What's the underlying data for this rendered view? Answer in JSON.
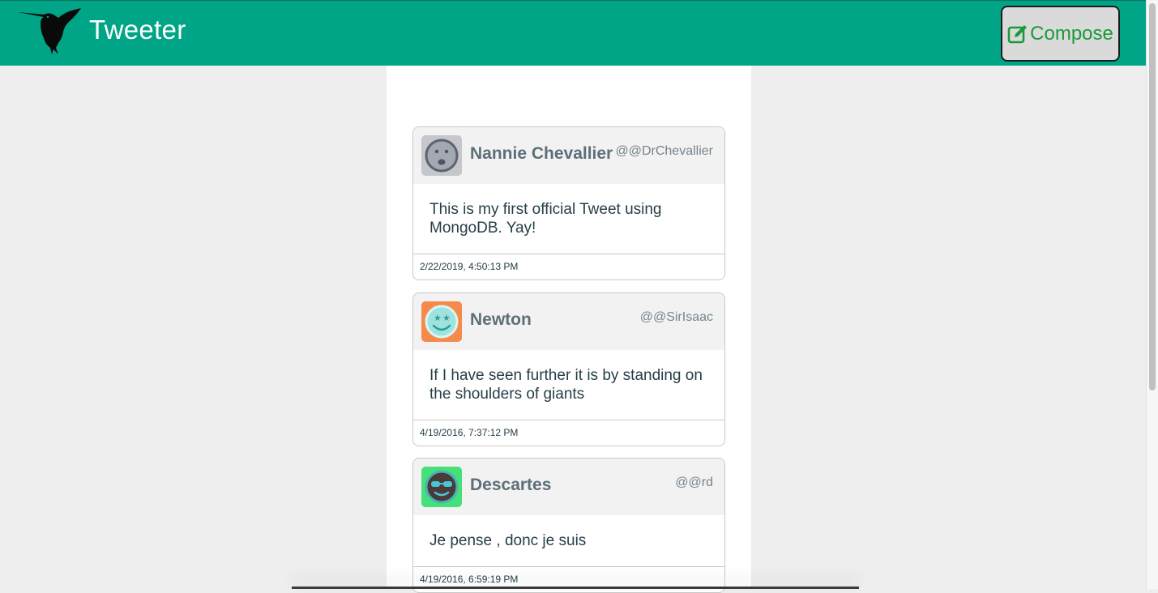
{
  "navbar": {
    "title": "Tweeter",
    "compose_label": "Compose",
    "bird_icon": "hummingbird-icon",
    "compose_icon": "edit-square-icon",
    "accent_color": "#00a587",
    "compose_color": "#1a9a3a"
  },
  "tweets": [
    {
      "name": "Nannie Chevallier",
      "handle": "@@DrChevallier",
      "text": "This is my first official Tweet using MongoDB. Yay!",
      "timestamp": "2/22/2019, 4:50:13 PM",
      "avatar_icon": "surprised-face-avatar-icon",
      "avatar_color": "#c5c7cc"
    },
    {
      "name": "Newton",
      "handle": "@@SirIsaac",
      "text": "If I have seen further it is by standing on the shoulders of giants",
      "timestamp": "4/19/2016, 7:37:12 PM",
      "avatar_icon": "star-eyes-face-avatar-icon",
      "avatar_color": "#f58a4b"
    },
    {
      "name": "Descartes",
      "handle": "@@rd",
      "text": "Je pense , donc je suis",
      "timestamp": "4/19/2016, 6:59:19 PM",
      "avatar_icon": "sunglasses-face-avatar-icon",
      "avatar_color": "#45e07a"
    }
  ]
}
